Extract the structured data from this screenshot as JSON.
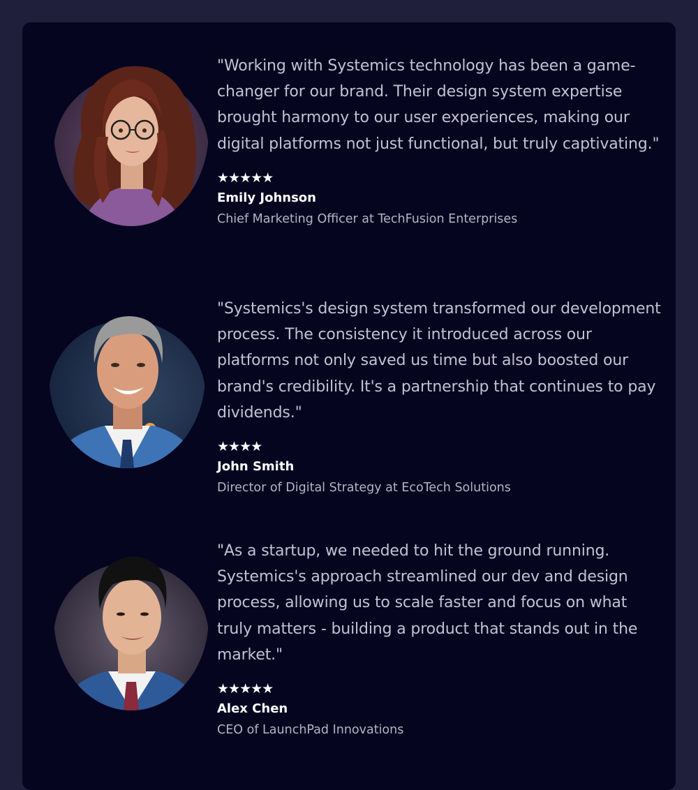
{
  "testimonials": [
    {
      "quote": "\"Working with Systemics technology has been a game-changer for our brand. Their design system expertise brought harmony to our user experiences, making our digital platforms not just functional, but truly captivating.\"",
      "stars": "★★★★★",
      "rating": 5,
      "name": "Emily Johnson",
      "role": "Chief Marketing Officer at TechFusion Enterprises",
      "avatar_icon": "woman-portrait"
    },
    {
      "quote": "\"Systemics's design system transformed our development process. The consistency it introduced across our platforms not only saved us time but also boosted our brand's credibility. It's a partnership that continues to pay dividends.\"",
      "stars": "★★★★",
      "rating": 4,
      "name": "John Smith",
      "role": "Director of Digital Strategy at EcoTech Solutions",
      "avatar_icon": "man-portrait"
    },
    {
      "quote": "\"As a startup, we needed to hit the ground running. Systemics's approach streamlined our dev and design process, allowing us to scale faster and focus on what truly matters - building a product that stands out in the market.\"",
      "stars": "★★★★★",
      "rating": 5,
      "name": "Alex Chen",
      "role": "CEO of LaunchPad Innovations",
      "avatar_icon": "man-portrait"
    }
  ],
  "colors": {
    "page_background": "#1f1f3b",
    "card_background": "#050520",
    "quote_text": "#c2c2d2",
    "name_text": "#ffffff",
    "role_text": "#b4b4c4"
  }
}
